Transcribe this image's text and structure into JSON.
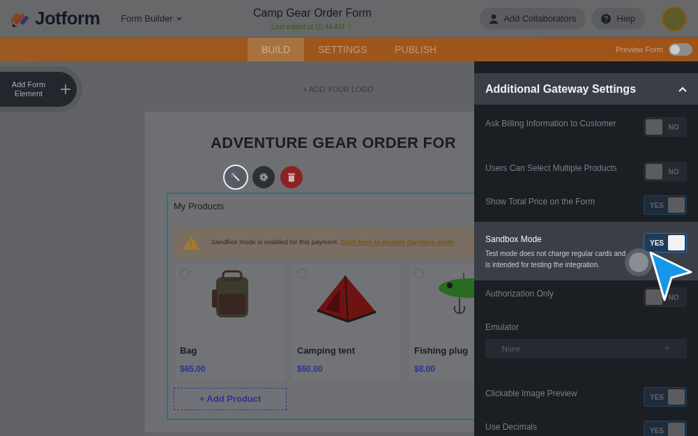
{
  "header": {
    "brand": "Jotform",
    "menu": "Form Builder",
    "title": "Camp Gear Order Form",
    "subtitle": "Last edited at 10:44 AM",
    "buttons": [
      {
        "label": "Add Collaborators",
        "kind": "collab"
      },
      {
        "label": "Help",
        "kind": "help"
      }
    ]
  },
  "tabs": [
    {
      "label": "BUILD",
      "selected": true
    },
    {
      "label": "SETTINGS",
      "selected": false
    },
    {
      "label": "PUBLISH",
      "selected": false
    }
  ],
  "preview": {
    "label": "Preview Form",
    "on": false
  },
  "add_element": "Add Form Element",
  "add_logo": "+ ADD YOUR LOGO",
  "form": {
    "title": "ADVENTURE GEAR ORDER FOR",
    "widget": {
      "title": "My Products",
      "warning": "Sandbox mode is enabled for this payment.",
      "warning_link": "Click here to disable Sandbox mode",
      "products": [
        {
          "name": "Bag",
          "price": "$65.00",
          "kind": "bag",
          "selected": false
        },
        {
          "name": "Camping tent",
          "price": "$60.00",
          "kind": "tent",
          "selected": false
        },
        {
          "name": "Fishing plug",
          "price": "$8.00",
          "kind": "lure",
          "selected": false
        }
      ],
      "add_product": "+ Add Product"
    }
  },
  "panel": {
    "title": "Additional Gateway Settings",
    "expanded": true,
    "settings": [
      {
        "kind": "toggle",
        "label": "Ask Billing Information to Customer",
        "on": false,
        "toggle_text": "NO",
        "highlighted": false
      },
      {
        "kind": "toggle",
        "label": "Users Can Select Multiple Products",
        "on": false,
        "toggle_text": "NO",
        "highlighted": false
      },
      {
        "kind": "toggle",
        "label": "Show Total Price on the Form",
        "on": true,
        "toggle_text": "YES",
        "highlighted": false
      },
      {
        "kind": "toggle",
        "label": "Sandbox Mode",
        "description": "Test mode does not charge regular cards and is intended for testing the integration.",
        "on": true,
        "toggle_text": "YES",
        "highlighted": true
      },
      {
        "kind": "toggle",
        "label": "Authorization Only",
        "on": false,
        "toggle_text": "NO",
        "highlighted": false
      },
      {
        "kind": "select",
        "label": "Emulator",
        "value": "None",
        "highlighted": false
      },
      {
        "kind": "toggle",
        "label": "Clickable Image Preview",
        "on": true,
        "toggle_text": "YES",
        "highlighted": false
      },
      {
        "kind": "toggle",
        "label": "Use Decimals",
        "on": true,
        "toggle_text": "YES",
        "highlighted": false
      }
    ]
  }
}
